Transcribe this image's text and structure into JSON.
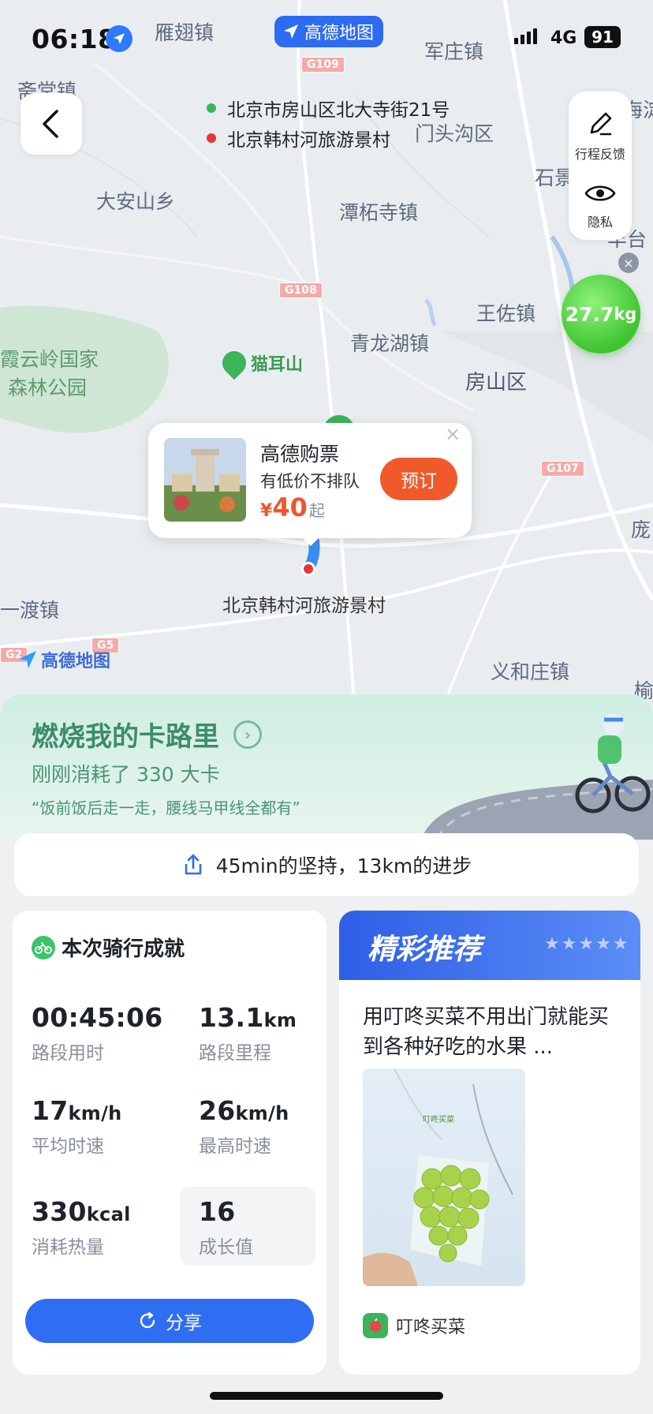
{
  "status": {
    "time": "06:18",
    "network": "4G",
    "battery": "91",
    "app_name": "高德地图"
  },
  "map": {
    "labels": [
      "雁翅镇",
      "军庄镇",
      "斋堂镇",
      "门头沟区",
      "大安山乡",
      "潭柘寺镇",
      "石景",
      "丰台",
      "王佐镇",
      "青龙湖镇",
      "房山区",
      "霞云岭国家",
      "森林公园",
      "一渡镇",
      "义和庄镇",
      "庞",
      "榆",
      "海淀"
    ],
    "road_shields": [
      "G109",
      "G108",
      "G107",
      "G5",
      "G2"
    ],
    "poi_name": "猫耳山",
    "destination_label": "北京韩村河旅游景村",
    "logo": "高德地图"
  },
  "route": {
    "origin": "北京市房山区北大寺街21号",
    "destination": "北京韩村河旅游景村",
    "origin_color": "#3ab55a",
    "destination_color": "#e8353a"
  },
  "side_tools": {
    "feedback": "行程反馈",
    "privacy": "隐私"
  },
  "carbon": {
    "value": "27.7",
    "unit": "kg"
  },
  "popup": {
    "title": "高德购票",
    "subtitle": "有低价不排队",
    "currency": "¥",
    "price": "40",
    "price_suffix": "起",
    "book_label": "预订",
    "close": "×"
  },
  "calorie": {
    "title": "燃烧我的卡路里",
    "subtitle": "刚刚消耗了 330 大卡",
    "quote": "“饭前饭后走一走，腰线马甲线全都有”",
    "share_text": "45min的坚持，13km的进步"
  },
  "achievement": {
    "title": "本次骑行成就",
    "stats": [
      {
        "value": "00:45:06",
        "unit": "",
        "label": "路段用时"
      },
      {
        "value": "13.1",
        "unit": "km",
        "label": "路段里程"
      },
      {
        "value": "17",
        "unit": "km/h",
        "label": "平均时速"
      },
      {
        "value": "26",
        "unit": "km/h",
        "label": "最高时速"
      },
      {
        "value": "330",
        "unit": "kcal",
        "label": "消耗热量"
      },
      {
        "value": "16",
        "unit": "",
        "label": "成长值"
      }
    ],
    "share_button": "分享"
  },
  "recommend": {
    "title": "精彩推荐",
    "stars": "★★★★★",
    "text": "用叮咚买菜不用出门就能买到各种好吃的水果 ...",
    "source": "叮咚买菜",
    "image_caption": "叮咚买菜"
  },
  "colors": {
    "accent": "#2f6ef3",
    "orange": "#f05a2b",
    "green": "#3d8c6a"
  }
}
